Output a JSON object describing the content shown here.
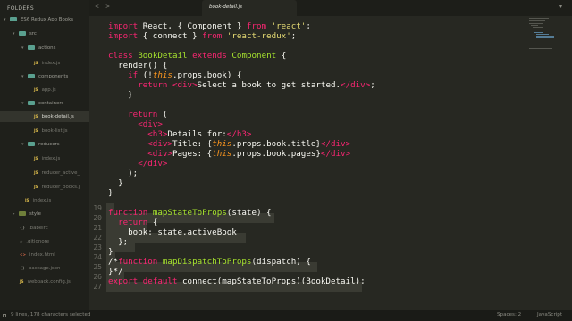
{
  "sidebar": {
    "title": "FOLDERS",
    "items": [
      {
        "label": "ES6 Redux  App Books",
        "kind": "folder-open"
      },
      {
        "label": "src",
        "kind": "folder-open"
      },
      {
        "label": "actions",
        "kind": "folder-open"
      },
      {
        "label": "index.js",
        "kind": "file"
      },
      {
        "label": "components",
        "kind": "folder-open"
      },
      {
        "label": "app.js",
        "kind": "file"
      },
      {
        "label": "containers",
        "kind": "folder-open"
      },
      {
        "label": "book-detail.js",
        "kind": "file"
      },
      {
        "label": "book-list.js",
        "kind": "file"
      },
      {
        "label": "reducers",
        "kind": "folder-open"
      },
      {
        "label": "index.js",
        "kind": "file"
      },
      {
        "label": "reducer_active_",
        "kind": "file"
      },
      {
        "label": "reducer_books.j",
        "kind": "file"
      },
      {
        "label": "index.js",
        "kind": "file"
      },
      {
        "label": "style",
        "kind": "folder-closed"
      },
      {
        "label": ".babelrc",
        "kind": "file"
      },
      {
        "label": ".gitignore",
        "kind": "file"
      },
      {
        "label": "index.html",
        "kind": "file"
      },
      {
        "label": "package.json",
        "kind": "file"
      },
      {
        "label": "webpack.config.js",
        "kind": "file"
      }
    ]
  },
  "tabs": {
    "nav_back": "<",
    "nav_forward": ">",
    "active_tab": "book-detail.js",
    "overflow": "▾"
  },
  "editor": {
    "line_numbers": [
      "19",
      "20",
      "21",
      "22",
      "23",
      "24",
      "25",
      "26",
      "27"
    ],
    "lines": [
      "import React, { Component } from 'react';",
      "import { connect } from 'react-redux';",
      "",
      "class BookDetail extends Component {",
      "  render() {",
      "    if (!this.props.book) {",
      "      return <div>Select a book to get started.</div>;",
      "    }",
      "",
      "    return (",
      "      <div>",
      "        <h3>Details for:</h3>",
      "        <div>Title: {this.props.book.title}</div>",
      "        <div>Pages: {this.props.book.pages}</div>",
      "      </div>",
      "    );",
      "  }",
      "}",
      "",
      "function mapStateToProps(state) {",
      "  return {",
      "    book: state.activeBook",
      "  };",
      "}",
      "/*function mapDispatchToProps(dispatch) {",
      "}*/",
      "export default connect(mapStateToProps)(BookDetail);"
    ]
  },
  "statusbar": {
    "selection": "9 lines, 178 characters selected",
    "spaces": "Spaces: 2",
    "syntax": "JavaScript"
  },
  "colors": {
    "background": "#272822",
    "sidebar": "#1f201b",
    "keyword": "#f92672",
    "string": "#e6db74",
    "class": "#a6e22e",
    "this": "#fd971f"
  }
}
